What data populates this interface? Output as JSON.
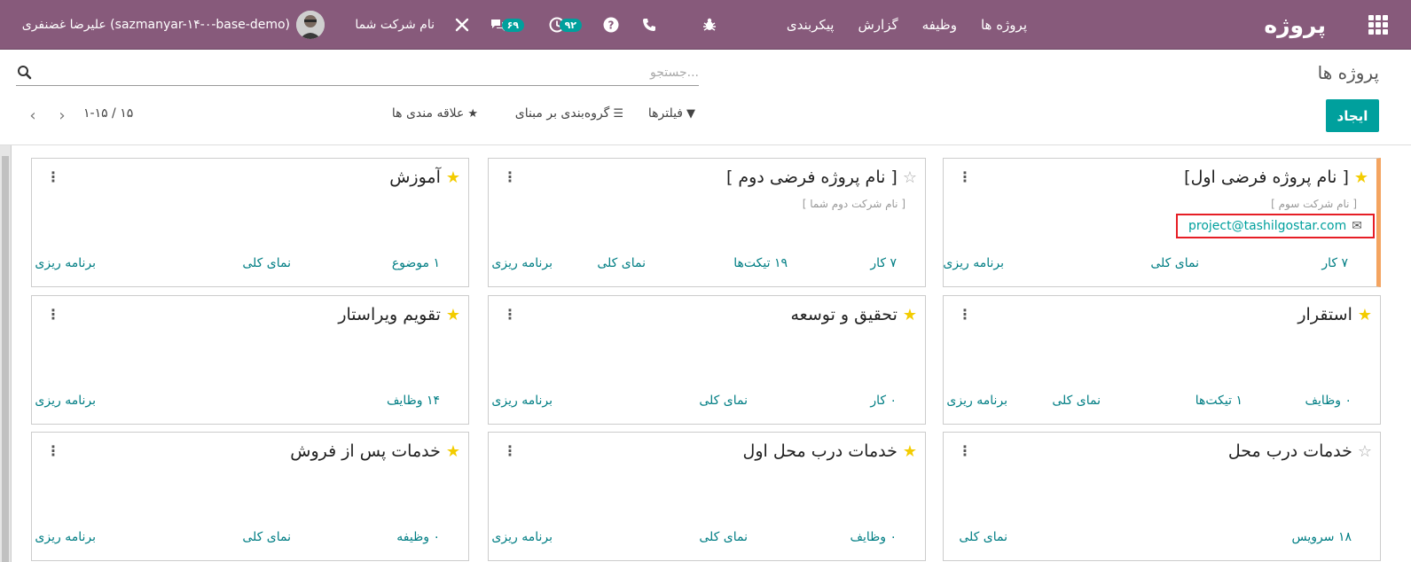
{
  "navbar": {
    "brand": "پروژه",
    "menu": [
      "پروژه ها",
      "وظیفه",
      "گزارش",
      "پیکربندی"
    ],
    "activity_count": "۹۲",
    "chat_count": "۶۹",
    "company": "نام شرکت شما",
    "user": "علیرضا غضنفری (sazmanyar-۱۴-۰-base-demo)",
    "colors": {
      "bar": "#875A7B",
      "badge": "#00A09D"
    }
  },
  "control": {
    "title": "پروژه ها",
    "search_placeholder": "جستجو...",
    "create_label": "ایجاد",
    "filters_label": "فیلترها",
    "groupby_label": "گروه‌بندی بر مبنای",
    "favorites_label": "علاقه مندی ها",
    "pager": "۱-۱۵ / ۱۵"
  },
  "cards": [
    {
      "title": "[ نام پروژه فرضی اول]",
      "starred": true,
      "subtitle": "[ نام شرکت سوم ]",
      "email": "project@tashilgostar.com",
      "links": [
        "۷ کار",
        "نمای کلی",
        "برنامه ریزی"
      ]
    },
    {
      "title": "[ نام پروژه فرضی دوم ]",
      "starred": false,
      "subtitle": "[ نام شرکت دوم شما ]",
      "links": [
        "۷ کار",
        "۱۹ تیکت‌ها",
        "نمای کلی",
        "برنامه ریزی"
      ]
    },
    {
      "title": "آموزش",
      "starred": true,
      "links": [
        "۱ موضوع",
        "نمای کلی",
        "برنامه ریزی"
      ]
    },
    {
      "title": "استقرار",
      "starred": true,
      "links": [
        "۰ وظایف",
        "۱ تیکت‌ها",
        "نمای کلی",
        "برنامه ریزی"
      ]
    },
    {
      "title": "تحقیق و توسعه",
      "starred": true,
      "links": [
        "۰ کار",
        "نمای کلی",
        "برنامه ریزی"
      ]
    },
    {
      "title": "تقویم ویراستار",
      "starred": true,
      "links": [
        "۱۴ وظایف",
        "برنامه ریزی"
      ]
    },
    {
      "title": "خدمات درب محل",
      "starred": false,
      "links": [
        "۱۸ سرویس",
        "نمای کلی"
      ]
    },
    {
      "title": "خدمات درب محل اول",
      "starred": true,
      "links": [
        "۰ وظایف",
        "نمای کلی",
        "برنامه ریزی"
      ]
    },
    {
      "title": "خدمات پس از فروش",
      "starred": true,
      "links": [
        "۰ وظیفه",
        "نمای کلی",
        "برنامه ریزی"
      ]
    }
  ]
}
